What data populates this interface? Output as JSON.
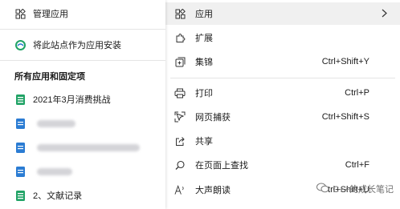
{
  "left_panel": {
    "manage_apps": {
      "label": "管理应用",
      "icon": "apps-icon"
    },
    "install_site": {
      "label": "将此站点作为应用安装",
      "icon": "edge-logo-icon"
    },
    "section_title": "所有应用和固定项",
    "items": [
      {
        "label": "2021年3月消费挑战",
        "icon": "green-sheet-icon",
        "blurred": false
      },
      {
        "label": "",
        "icon": "blue-doc-icon",
        "blurred": true
      },
      {
        "label": "",
        "icon": "blue-doc-icon",
        "blurred": true
      },
      {
        "label": "",
        "icon": "blue-doc-icon",
        "blurred": true
      },
      {
        "label": "2、文献记录",
        "icon": "green-sheet-icon",
        "blurred": false
      }
    ]
  },
  "menu": {
    "apps": {
      "label": "应用",
      "icon": "apps-icon",
      "submenu_icon": "chevron-right-icon"
    },
    "extensions": {
      "label": "扩展",
      "icon": "puzzle-icon"
    },
    "collections": {
      "label": "集锦",
      "shortcut": "Ctrl+Shift+Y",
      "icon": "collections-icon"
    },
    "print": {
      "label": "打印",
      "shortcut": "Ctrl+P",
      "icon": "printer-icon"
    },
    "web_capture": {
      "label": "网页捕获",
      "shortcut": "Ctrl+Shift+S",
      "icon": "web-capture-icon"
    },
    "share": {
      "label": "共享",
      "icon": "share-icon"
    },
    "find": {
      "label": "在页面上查找",
      "shortcut": "Ctrl+F",
      "icon": "find-icon"
    },
    "read_aloud": {
      "label": "大声朗读",
      "shortcut": "Ctrl+Shift+U",
      "icon": "read-aloud-icon"
    }
  },
  "watermark": {
    "text": "C++的成长笔记",
    "icon": "wechat-icon"
  },
  "colors": {
    "hover": "#f0f0f0",
    "sheet_green": "#21a366",
    "doc_blue": "#2b7cd3",
    "separator": "#e5e5e5"
  }
}
